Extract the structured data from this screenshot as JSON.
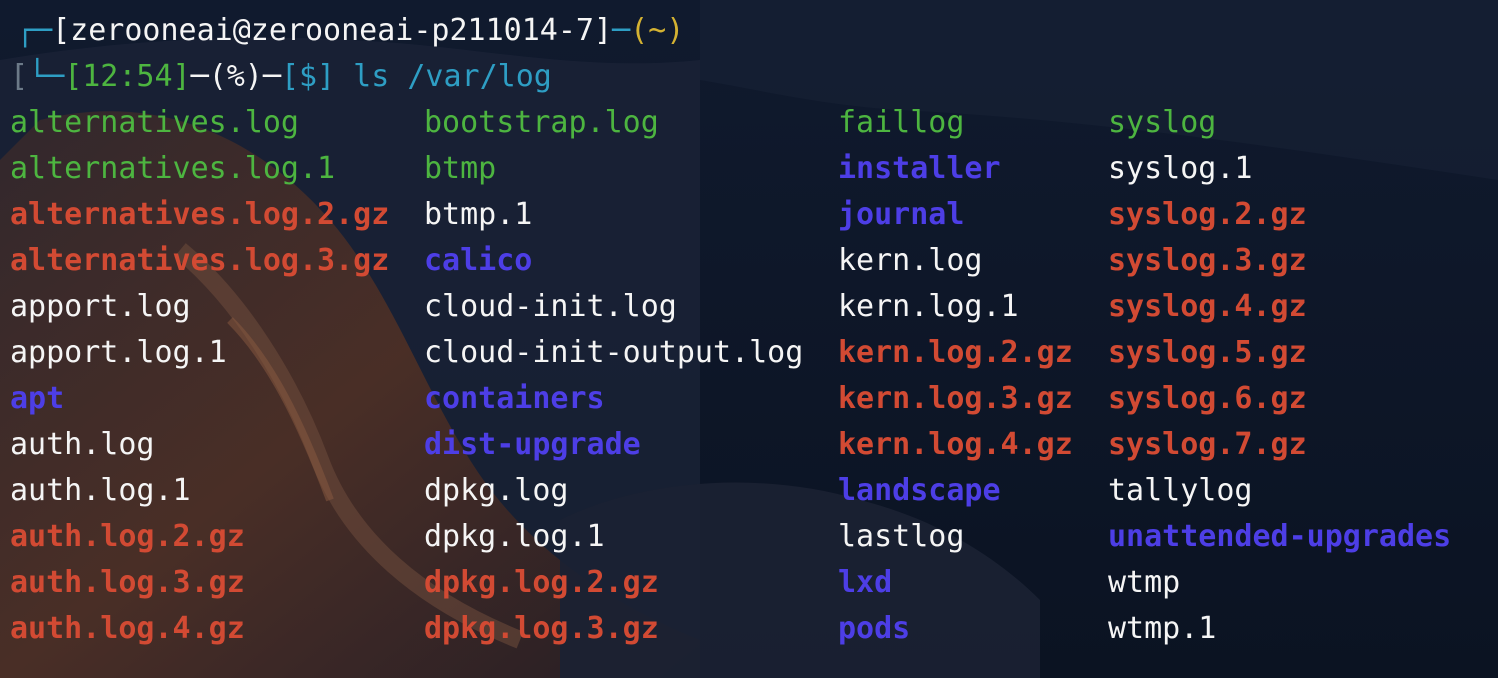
{
  "window": {
    "type": "terminal"
  },
  "prompt": {
    "line1": {
      "corner": "┌─",
      "user_host": "[zerooneai@zerooneai-p211014-7]",
      "dash": "─",
      "cwd": "(~)"
    },
    "line2": {
      "cursor_mark": "[",
      "corner": "└─",
      "time": "[12:54]",
      "dash1": "─",
      "percent": "(%)",
      "dash2": "─",
      "symbol": "[$]",
      "command": " ls /var/log"
    }
  },
  "ls_output": {
    "columns": [
      [
        {
          "name": "alternatives.log",
          "kind": "exec"
        },
        {
          "name": "alternatives.log.1",
          "kind": "exec"
        },
        {
          "name": "alternatives.log.2.gz",
          "kind": "archive"
        },
        {
          "name": "alternatives.log.3.gz",
          "kind": "archive"
        },
        {
          "name": "apport.log",
          "kind": "file"
        },
        {
          "name": "apport.log.1",
          "kind": "file"
        },
        {
          "name": "apt",
          "kind": "dir"
        },
        {
          "name": "auth.log",
          "kind": "file"
        },
        {
          "name": "auth.log.1",
          "kind": "file"
        },
        {
          "name": "auth.log.2.gz",
          "kind": "archive"
        },
        {
          "name": "auth.log.3.gz",
          "kind": "archive"
        },
        {
          "name": "auth.log.4.gz",
          "kind": "archive"
        }
      ],
      [
        {
          "name": "bootstrap.log",
          "kind": "exec"
        },
        {
          "name": "btmp",
          "kind": "exec"
        },
        {
          "name": "btmp.1",
          "kind": "file"
        },
        {
          "name": "calico",
          "kind": "dir"
        },
        {
          "name": "cloud-init.log",
          "kind": "file"
        },
        {
          "name": "cloud-init-output.log",
          "kind": "file"
        },
        {
          "name": "containers",
          "kind": "dir"
        },
        {
          "name": "dist-upgrade",
          "kind": "dir"
        },
        {
          "name": "dpkg.log",
          "kind": "file"
        },
        {
          "name": "dpkg.log.1",
          "kind": "file"
        },
        {
          "name": "dpkg.log.2.gz",
          "kind": "archive"
        },
        {
          "name": "dpkg.log.3.gz",
          "kind": "archive"
        }
      ],
      [
        {
          "name": "faillog",
          "kind": "exec"
        },
        {
          "name": "installer",
          "kind": "dir"
        },
        {
          "name": "journal",
          "kind": "dir"
        },
        {
          "name": "kern.log",
          "kind": "file"
        },
        {
          "name": "kern.log.1",
          "kind": "file"
        },
        {
          "name": "kern.log.2.gz",
          "kind": "archive"
        },
        {
          "name": "kern.log.3.gz",
          "kind": "archive"
        },
        {
          "name": "kern.log.4.gz",
          "kind": "archive"
        },
        {
          "name": "landscape",
          "kind": "dir"
        },
        {
          "name": "lastlog",
          "kind": "file"
        },
        {
          "name": "lxd",
          "kind": "dir"
        },
        {
          "name": "pods",
          "kind": "dir"
        }
      ],
      [
        {
          "name": "syslog",
          "kind": "exec"
        },
        {
          "name": "syslog.1",
          "kind": "file"
        },
        {
          "name": "syslog.2.gz",
          "kind": "archive"
        },
        {
          "name": "syslog.3.gz",
          "kind": "archive"
        },
        {
          "name": "syslog.4.gz",
          "kind": "archive"
        },
        {
          "name": "syslog.5.gz",
          "kind": "archive"
        },
        {
          "name": "syslog.6.gz",
          "kind": "archive"
        },
        {
          "name": "syslog.7.gz",
          "kind": "archive"
        },
        {
          "name": "tallylog",
          "kind": "file"
        },
        {
          "name": "unattended-upgrades",
          "kind": "dir"
        },
        {
          "name": "wtmp",
          "kind": "file"
        },
        {
          "name": "wtmp.1",
          "kind": "file"
        }
      ]
    ]
  },
  "colors": {
    "exec": "#4db540",
    "archive": "#d24a33",
    "dir": "#4d3ee6",
    "file": "#f5f5f5",
    "prompt_green": "#4db540",
    "prompt_yellow": "#d4b232",
    "prompt_cyan": "#2e9ec4",
    "background": "#0d1526"
  }
}
